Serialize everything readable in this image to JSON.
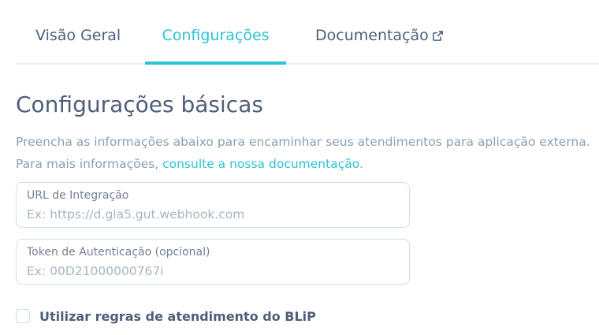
{
  "tabs": {
    "overview": "Visão Geral",
    "settings": "Configurações",
    "docs": "Documentação"
  },
  "icons": {
    "docs_external": "external-link-icon"
  },
  "colors": {
    "accent": "#2CC3D5",
    "text": "#505F79",
    "muted": "#8CA0B3",
    "border": "#D2DFE6"
  },
  "page": {
    "title": "Configurações básicas",
    "description_line1": "Preencha as informações abaixo para encaminhar seus atendimentos para aplicação externa.",
    "description_line2_prefix": "Para mais informações, ",
    "description_link": "consulte a nossa documentação",
    "description_line2_suffix": "."
  },
  "fields": {
    "url": {
      "label": "URL de Integração",
      "placeholder": "Ex: https://d.gla5.gut.webhook.com",
      "value": ""
    },
    "token": {
      "label": "Token de Autenticação (opcional)",
      "placeholder": "Ex: 00D21000000767i",
      "value": ""
    }
  },
  "checkbox": {
    "label": "Utilizar regras de atendimento do BLiP",
    "checked": false
  }
}
